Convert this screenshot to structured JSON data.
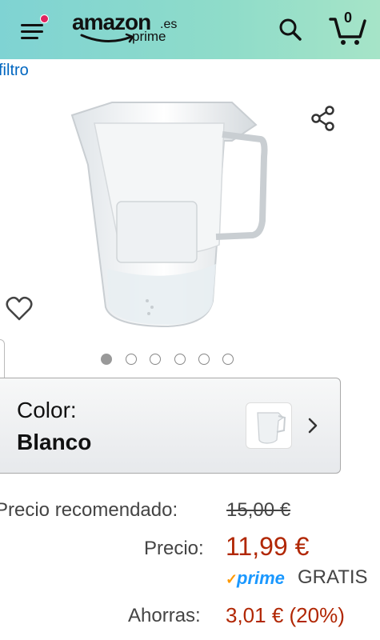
{
  "header": {
    "logo_text": "amazon",
    "logo_tld": ".es",
    "logo_prime": "prime",
    "cart_count": "0",
    "icons": {
      "menu": "hamburger-menu-icon",
      "notification": "notification-dot-icon",
      "search": "search-icon",
      "cart": "cart-icon"
    },
    "colors": {
      "gradient_start": "#7fd3d3",
      "gradient_end": "#a6e4c8",
      "badge": "#e0245e"
    }
  },
  "breadcrumb_link": "filtro",
  "gallery": {
    "image_alt": "water-filter-jug-image",
    "dot_count": 6,
    "active_dot": 0,
    "icons": {
      "share": "share-icon",
      "favorite": "heart-icon"
    }
  },
  "variant": {
    "label": "Color:",
    "value": "Blanco",
    "icons": {
      "chevron": "chevron-right-icon"
    }
  },
  "pricing": {
    "recommended_label": "Precio recomendado:",
    "recommended_value": "15,00 €",
    "price_label": "Precio:",
    "price_value": "11,99 €",
    "prime_label": "prime",
    "shipping": "GRATIS",
    "savings_label": "Ahorras:",
    "savings_value": "3,01 € (20%)",
    "colors": {
      "price": "#b12704",
      "prime": "#1a98ff",
      "prime_check": "#ff9900",
      "link": "#0066c0"
    }
  }
}
